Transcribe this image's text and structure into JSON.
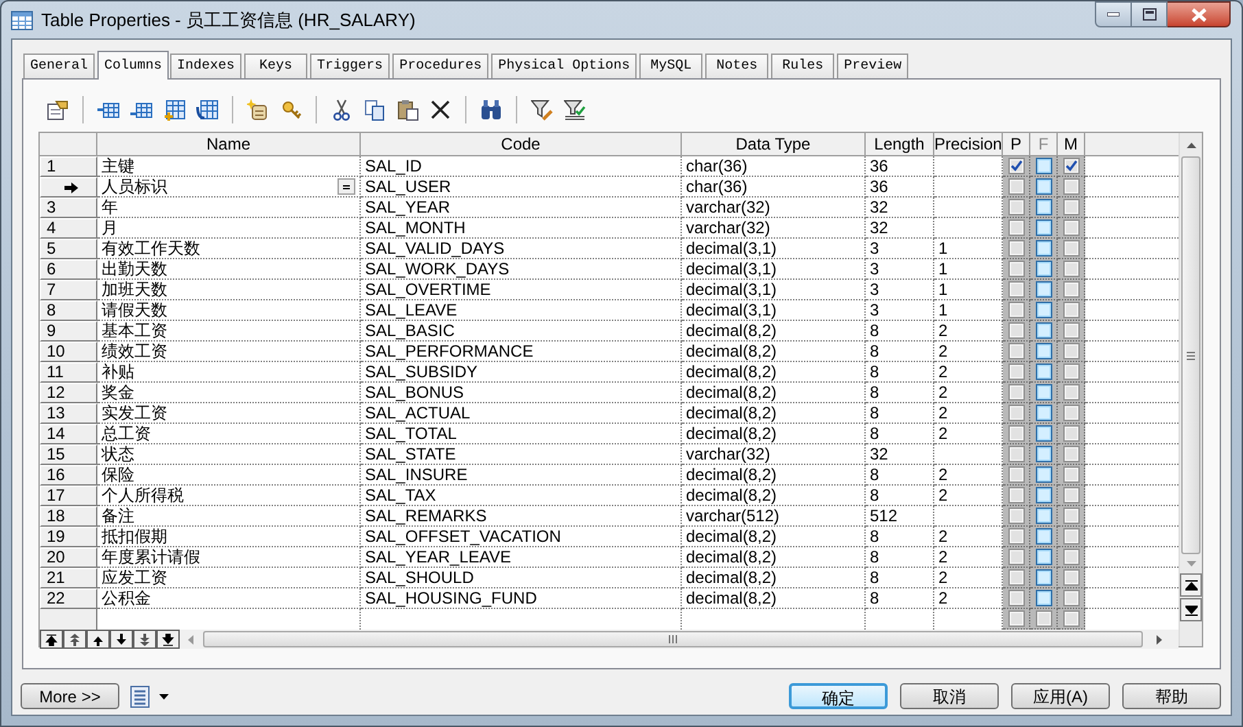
{
  "window": {
    "title": "Table Properties - 员工工资信息 (HR_SALARY)"
  },
  "tabs": [
    {
      "label": "General",
      "selected": false
    },
    {
      "label": "Columns",
      "selected": true
    },
    {
      "label": "Indexes",
      "selected": false
    },
    {
      "label": "Keys",
      "selected": false
    },
    {
      "label": "Triggers",
      "selected": false
    },
    {
      "label": "Procedures",
      "selected": false
    },
    {
      "label": "Physical Options",
      "selected": false
    },
    {
      "label": "MySQL",
      "selected": false
    },
    {
      "label": "Notes",
      "selected": false
    },
    {
      "label": "Rules",
      "selected": false
    },
    {
      "label": "Preview",
      "selected": false
    }
  ],
  "table": {
    "columns": [
      {
        "label": "Name",
        "disabled": false
      },
      {
        "label": "Code",
        "disabled": false
      },
      {
        "label": "Data Type",
        "disabled": false
      },
      {
        "label": "Length",
        "disabled": false
      },
      {
        "label": "Precision",
        "disabled": false
      },
      {
        "label": "P",
        "disabled": false
      },
      {
        "label": "F",
        "disabled": true
      },
      {
        "label": "M",
        "disabled": false
      }
    ],
    "rows": [
      {
        "number": "1",
        "current": false,
        "name": "主键",
        "code": "SAL_ID",
        "data_type": "char(36)",
        "length": "36",
        "p": true,
        "f": false,
        "m": true
      },
      {
        "current": true,
        "name": "人员标识",
        "code": "SAL_USER",
        "data_type": "char(36)",
        "length": "36",
        "p": false,
        "f": false,
        "m": false
      },
      {
        "number": "3",
        "current": false,
        "name": "年",
        "code": "SAL_YEAR",
        "data_type": "varchar(32)",
        "length": "32",
        "p": false,
        "f": false,
        "m": false
      },
      {
        "number": "4",
        "current": false,
        "name": "月",
        "code": "SAL_MONTH",
        "data_type": "varchar(32)",
        "length": "32",
        "p": false,
        "f": false,
        "m": false
      },
      {
        "number": "5",
        "current": false,
        "name": "有效工作天数",
        "code": "SAL_VALID_DAYS",
        "data_type": "decimal(3,1)",
        "length": "3",
        "precision": "1",
        "p": false,
        "f": false,
        "m": false
      },
      {
        "number": "6",
        "current": false,
        "name": "出勤天数",
        "code": "SAL_WORK_DAYS",
        "data_type": "decimal(3,1)",
        "length": "3",
        "precision": "1",
        "p": false,
        "f": false,
        "m": false
      },
      {
        "number": "7",
        "current": false,
        "name": "加班天数",
        "code": "SAL_OVERTIME",
        "data_type": "decimal(3,1)",
        "length": "3",
        "precision": "1",
        "p": false,
        "f": false,
        "m": false
      },
      {
        "number": "8",
        "current": false,
        "name": "请假天数",
        "code": "SAL_LEAVE",
        "data_type": "decimal(3,1)",
        "length": "3",
        "precision": "1",
        "p": false,
        "f": false,
        "m": false
      },
      {
        "number": "9",
        "current": false,
        "name": "基本工资",
        "code": "SAL_BASIC",
        "data_type": "decimal(8,2)",
        "length": "8",
        "precision": "2",
        "p": false,
        "f": false,
        "m": false
      },
      {
        "number": "10",
        "current": false,
        "name": "绩效工资",
        "code": "SAL_PERFORMANCE",
        "data_type": "decimal(8,2)",
        "length": "8",
        "precision": "2",
        "p": false,
        "f": false,
        "m": false
      },
      {
        "number": "11",
        "current": false,
        "name": "补贴",
        "code": "SAL_SUBSIDY",
        "data_type": "decimal(8,2)",
        "length": "8",
        "precision": "2",
        "p": false,
        "f": false,
        "m": false
      },
      {
        "number": "12",
        "current": false,
        "name": "奖金",
        "code": "SAL_BONUS",
        "data_type": "decimal(8,2)",
        "length": "8",
        "precision": "2",
        "p": false,
        "f": false,
        "m": false
      },
      {
        "number": "13",
        "current": false,
        "name": "实发工资",
        "code": "SAL_ACTUAL",
        "data_type": "decimal(8,2)",
        "length": "8",
        "precision": "2",
        "p": false,
        "f": false,
        "m": false
      },
      {
        "number": "14",
        "current": false,
        "name": "总工资",
        "code": "SAL_TOTAL",
        "data_type": "decimal(8,2)",
        "length": "8",
        "precision": "2",
        "p": false,
        "f": false,
        "m": false
      },
      {
        "number": "15",
        "current": false,
        "name": "状态",
        "code": "SAL_STATE",
        "data_type": "varchar(32)",
        "length": "32",
        "p": false,
        "f": false,
        "m": false
      },
      {
        "number": "16",
        "current": false,
        "name": "保险",
        "code": "SAL_INSURE",
        "data_type": "decimal(8,2)",
        "length": "8",
        "precision": "2",
        "p": false,
        "f": false,
        "m": false
      },
      {
        "number": "17",
        "current": false,
        "name": "个人所得税",
        "code": "SAL_TAX",
        "data_type": "decimal(8,2)",
        "length": "8",
        "precision": "2",
        "p": false,
        "f": false,
        "m": false
      },
      {
        "number": "18",
        "current": false,
        "name": "备注",
        "code": "SAL_REMARKS",
        "data_type": "varchar(512)",
        "length": "512",
        "p": false,
        "f": false,
        "m": false
      },
      {
        "number": "19",
        "current": false,
        "name": "抵扣假期",
        "code": "SAL_OFFSET_VACATION",
        "data_type": "decimal(8,2)",
        "length": "8",
        "precision": "2",
        "p": false,
        "f": false,
        "m": false
      },
      {
        "number": "20",
        "current": false,
        "name": "年度累计请假",
        "code": "SAL_YEAR_LEAVE",
        "data_type": "decimal(8,2)",
        "length": "8",
        "precision": "2",
        "p": false,
        "f": false,
        "m": false
      },
      {
        "number": "21",
        "current": false,
        "name": "应发工资",
        "code": "SAL_SHOULD",
        "data_type": "decimal(8,2)",
        "length": "8",
        "precision": "2",
        "p": false,
        "f": false,
        "m": false
      },
      {
        "number": "22",
        "current": false,
        "name": "公积金",
        "code": "SAL_HOUSING_FUND",
        "data_type": "decimal(8,2)",
        "length": "8",
        "precision": "2",
        "p": false,
        "f": false,
        "m": false
      }
    ],
    "blank_row": {
      "p": false,
      "f": false,
      "m": false
    }
  },
  "more_button": {
    "label": "More >>"
  },
  "buttons": [
    {
      "label": "确定",
      "default": true
    },
    {
      "label": "取消",
      "default": false
    },
    {
      "label": "应用(A)",
      "default": false
    },
    {
      "label": "帮助",
      "default": false
    }
  ]
}
